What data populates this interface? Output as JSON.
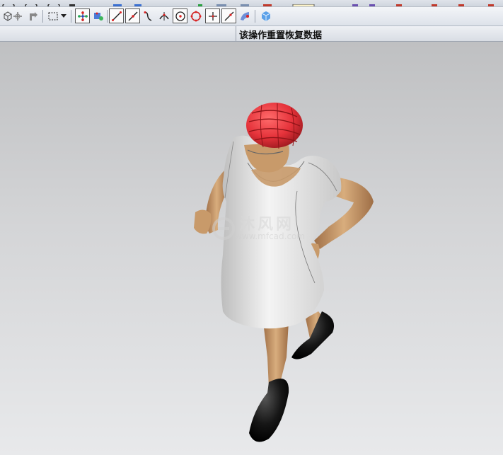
{
  "status_bar": {
    "message": "该操作重置恢复数据"
  },
  "viewport": {
    "watermark": {
      "brand": "沐风网",
      "url": "www.mfcad.com"
    }
  },
  "toolbar": {
    "icons": [
      "view-cube-icon",
      "rotate-icon",
      "pan-icon",
      "rect-select-icon",
      "dropdown-icon",
      "snap-points-icon",
      "snap-grid-icon",
      "line-icon",
      "line-midpoint-icon",
      "curve-icon",
      "intersection-icon",
      "circle-center-icon",
      "circle-quadrant-icon",
      "cross-point-icon",
      "line-point-icon",
      "sheet-point-icon",
      "solid-cube-icon"
    ]
  },
  "colors": {
    "viewport_top": "#bfc0c2",
    "viewport_bottom": "#e8e9eb",
    "hat": "#e5323a",
    "dress": "#ececec",
    "skin": "#c89a6a",
    "shoes": "#141414"
  }
}
